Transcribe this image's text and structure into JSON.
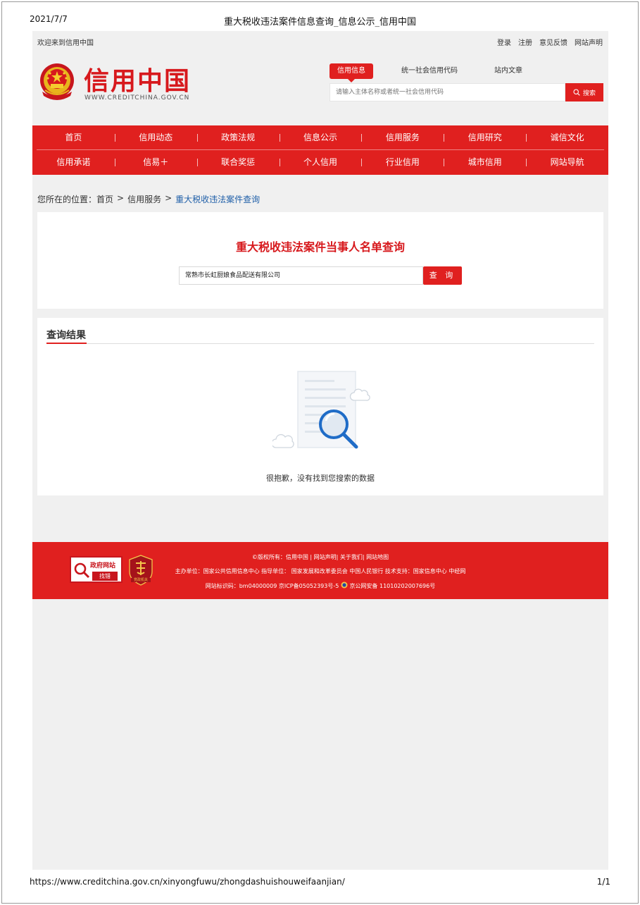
{
  "print": {
    "date": "2021/7/7",
    "title": "重大税收违法案件信息查询_信息公示_信用中国",
    "url": "https://www.creditchina.gov.cn/xinyongfuwu/zhongdashuishouweifaanjian/",
    "page": "1/1"
  },
  "topbar": {
    "welcome": "欢迎来到信用中国",
    "links": [
      "登录",
      "注册",
      "意见反馈",
      "网站声明"
    ]
  },
  "logo": {
    "cn": "信用中国",
    "en": "WWW.CREDITCHINA.GOV.CN"
  },
  "search": {
    "tabs": [
      "信用信息",
      "统一社会信用代码",
      "站内文章"
    ],
    "placeholder": "请输入主体名称或者统一社会信用代码",
    "button": "搜索"
  },
  "nav": {
    "row1": [
      "首页",
      "信用动态",
      "政策法规",
      "信息公示",
      "信用服务",
      "信用研究",
      "诚信文化"
    ],
    "row2": [
      "信用承诺",
      "信易＋",
      "联合奖惩",
      "个人信用",
      "行业信用",
      "城市信用",
      "网站导航"
    ]
  },
  "breadcrumb": {
    "prefix": "您所在的位置：",
    "home": "首页",
    "sep": ">",
    "section": "信用服务",
    "current": "重大税收违法案件查询"
  },
  "query": {
    "title": "重大税收违法案件当事人名单查询",
    "input_value": "常熟市长虹厨娘食品配送有限公司",
    "button": "查 询"
  },
  "result": {
    "title": "查询结果",
    "empty_message": "很抱歉，没有找到您搜索的数据"
  },
  "footer": {
    "gov_badge_line1": "政府网站",
    "gov_badge_line2": "找错",
    "party_badge_text": "党政机关",
    "line1": "©版权所有：信用中国 | 网站声明| 关于我们| 网站地图",
    "line2": "主办单位：国家公共信用信息中心   指导单位： 国家发展和改革委员会  中国人民银行   技术支持：国家信息中心  中经网",
    "line3_a": "网站标识码：bm04000009 京ICP备05052393号-5",
    "line3_b": "京公网安备 11010202007696号"
  },
  "colors": {
    "brand_red": "#e0201f",
    "link_blue": "#1f5fa8",
    "page_bg": "#f0f0f0"
  }
}
